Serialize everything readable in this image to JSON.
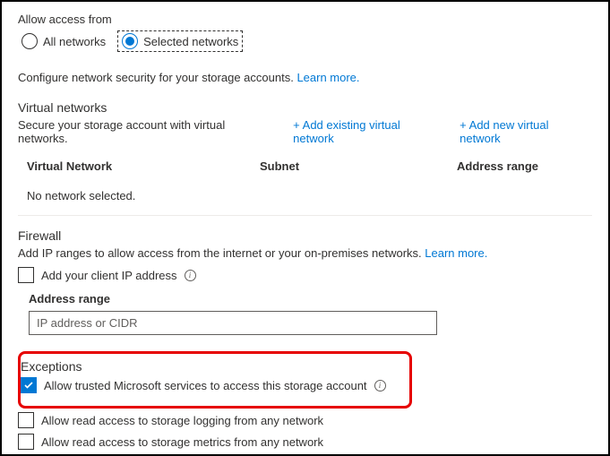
{
  "allowAccess": {
    "title": "Allow access from",
    "options": {
      "all": "All networks",
      "selected": "Selected networks"
    }
  },
  "configDesc": {
    "text": "Configure network security for your storage accounts. ",
    "link": "Learn more."
  },
  "vnet": {
    "title": "Virtual networks",
    "desc": "Secure your storage account with virtual networks.",
    "addExisting": "+ Add existing virtual network",
    "addNew": "+ Add new virtual network",
    "columns": {
      "network": "Virtual Network",
      "subnet": "Subnet",
      "range": "Address range"
    },
    "empty": "No network selected."
  },
  "firewall": {
    "title": "Firewall",
    "desc": "Add IP ranges to allow access from the internet or your on-premises networks. ",
    "link": "Learn more.",
    "addClientIp": "Add your client IP address",
    "rangeLabel": "Address range",
    "rangePlaceholder": "IP address or CIDR"
  },
  "exceptions": {
    "title": "Exceptions",
    "trusted": "Allow trusted Microsoft services to access this storage account",
    "logging": "Allow read access to storage logging from any network",
    "metrics": "Allow read access to storage metrics from any network"
  }
}
